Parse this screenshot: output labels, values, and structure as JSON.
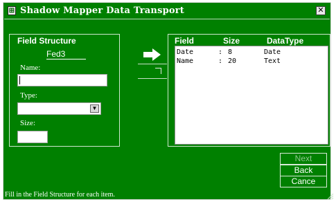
{
  "window": {
    "title": "Shadow Mapper Data Transport",
    "close_glyph": "✕",
    "icon": "app-icon"
  },
  "field_structure": {
    "heading": "Field Structure",
    "current_field": "Fed3",
    "name_label": "Name:",
    "name_value": "",
    "type_label": "Type:",
    "type_value": "",
    "size_label": "Size:",
    "size_value": ""
  },
  "list": {
    "headers": {
      "field": "Field",
      "size": "Size",
      "datatype": "DataType"
    },
    "rows": [
      {
        "field": "Date",
        "sep": ":",
        "size": "8",
        "datatype": "Date"
      },
      {
        "field": "Name",
        "sep": ":",
        "size": "20",
        "datatype": "Text"
      }
    ]
  },
  "buttons": {
    "next": "Next",
    "back": "Back",
    "cancel": "Cance"
  },
  "status": "Fill in the Field Structure for each item.",
  "colors": {
    "background": "#008000",
    "text": "#ffffff",
    "arrow": "#ffffff"
  }
}
